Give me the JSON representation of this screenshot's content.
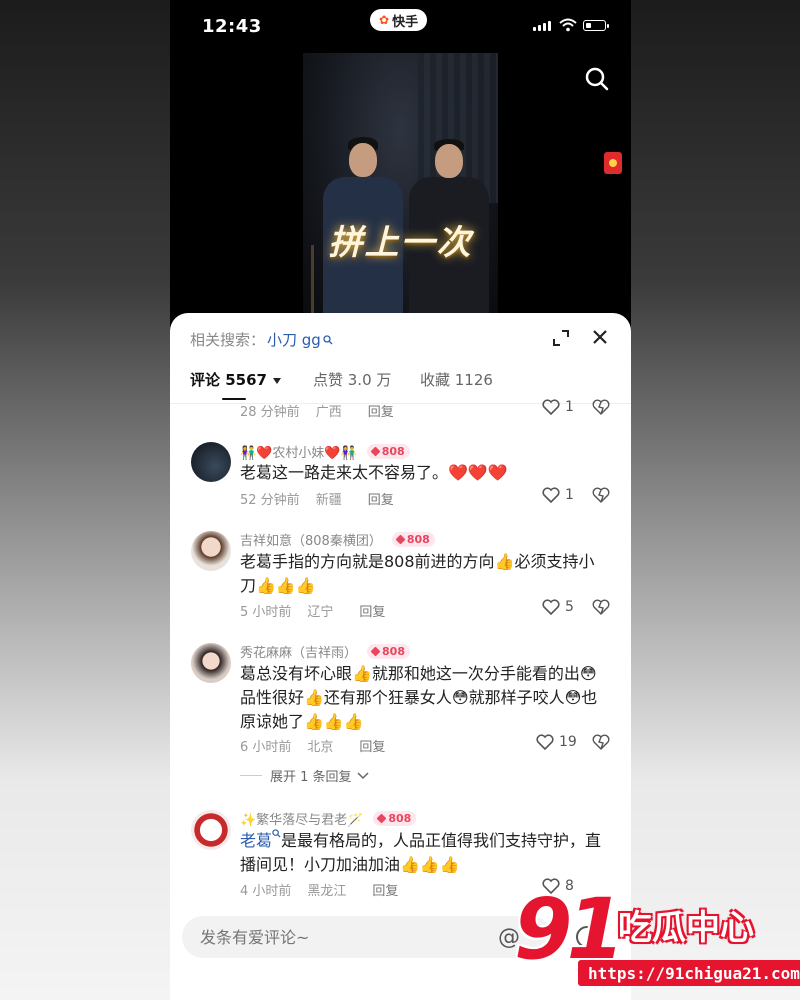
{
  "status_bar": {
    "time": "12:43",
    "app_name": "快手"
  },
  "video": {
    "caption": "拼上一次"
  },
  "comment_sheet": {
    "related_label": "相关搜索：",
    "related_keyword": "小刀 gg",
    "tabs": [
      {
        "label": "评论 5567"
      },
      {
        "label": "点赞 3.0 万"
      },
      {
        "label": "收藏 1126"
      }
    ]
  },
  "comments": [
    {
      "meta_time": "28 分钟前",
      "meta_loc": "广西",
      "reply": "回复",
      "likes": "1"
    },
    {
      "username": "👫❤️农村小妹❤️👫",
      "badge": "808",
      "text": "老葛这一路走来太不容易了。❤️❤️❤️",
      "meta_time": "52 分钟前",
      "meta_loc": "新疆",
      "reply": "回复",
      "likes": "1"
    },
    {
      "username": "吉祥如意（808秦横团）",
      "badge": "808",
      "text": "老葛手指的方向就是808前进的方向👍必须支持小刀👍👍👍",
      "meta_time": "5 小时前",
      "meta_loc": "辽宁",
      "reply": "回复",
      "likes": "5"
    },
    {
      "username": "秀花麻麻（吉祥雨）",
      "badge": "808",
      "text": "葛总没有坏心眼👍就那和她这一次分手能看的出😳品性很好👍还有那个狂暴女人😳就那样子咬人😳也原谅她了👍👍👍",
      "meta_time": "6 小时前",
      "meta_loc": "北京",
      "reply": "回复",
      "likes": "19",
      "expand_replies": "展开 1 条回复"
    },
    {
      "username": "✨繁华落尽与君老🪄",
      "badge": "808",
      "mention": "老葛",
      "text": "是最有格局的，人品正值得我们支持守护，直播间见！小刀加油加油👍👍👍",
      "meta_time": "4 小时前",
      "meta_loc": "黑龙江",
      "reply": "回复",
      "likes": "8"
    }
  ],
  "input": {
    "placeholder": "发条有爱评论~"
  },
  "watermark": {
    "number": "91",
    "text": "吃瓜中心",
    "url": "https://91chigua21.com"
  },
  "colors": {
    "accent_link": "#2a5db0",
    "badge_pink": "#e8465e",
    "watermark_red": "#e5152f"
  }
}
